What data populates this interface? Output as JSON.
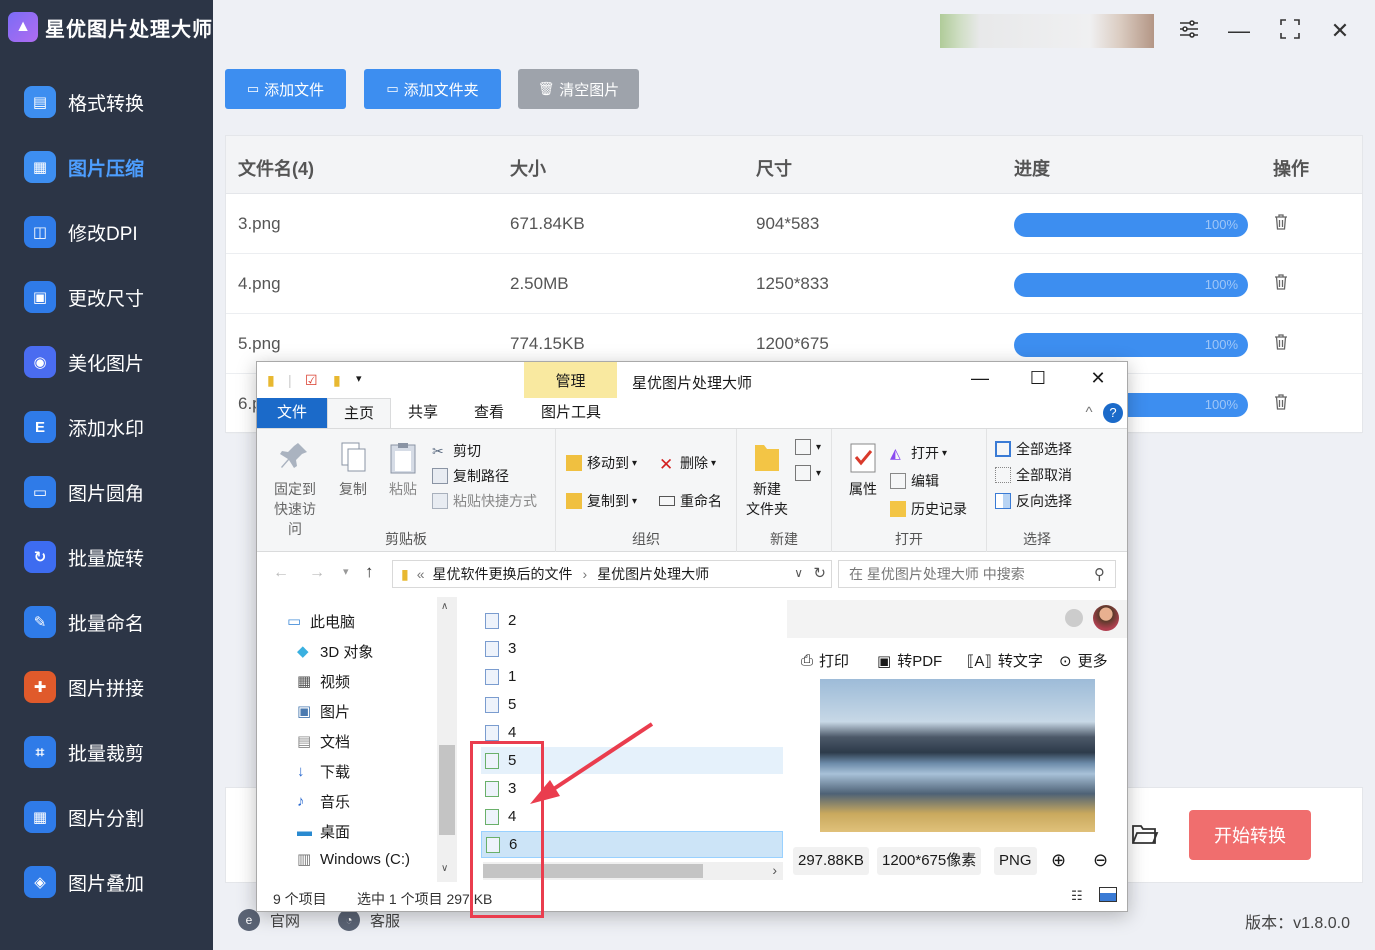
{
  "app": {
    "title": "星优图片处理大师",
    "version": "版本：v1.8.0.0"
  },
  "sidebar": {
    "items": [
      {
        "label": "格式转换",
        "color": "#3d8ef0"
      },
      {
        "label": "图片压缩",
        "color": "#3d8ef0",
        "active": true
      },
      {
        "label": "修改DPI",
        "color": "#2f7be8"
      },
      {
        "label": "更改尺寸",
        "color": "#2f7be8"
      },
      {
        "label": "美化图片",
        "color": "#4a6cf0"
      },
      {
        "label": "添加水印",
        "color": "#2f7be8"
      },
      {
        "label": "图片圆角",
        "color": "#2f7be8"
      },
      {
        "label": "批量旋转",
        "color": "#3d6cf0"
      },
      {
        "label": "批量命名",
        "color": "#2f7be8"
      },
      {
        "label": "图片拼接",
        "color": "#e05a2b"
      },
      {
        "label": "批量裁剪",
        "color": "#2f7be8"
      },
      {
        "label": "图片分割",
        "color": "#2f7be8"
      },
      {
        "label": "图片叠加",
        "color": "#2f7be8"
      }
    ]
  },
  "toolbar": {
    "add_file": "添加文件",
    "add_folder": "添加文件夹",
    "clear": "清空图片"
  },
  "table": {
    "headers": {
      "name": "文件名(4)",
      "size": "大小",
      "dims": "尺寸",
      "progress": "进度",
      "action": "操作"
    },
    "rows": [
      {
        "name": "3.png",
        "size": "671.84KB",
        "dims": "904*583",
        "progress": "100%"
      },
      {
        "name": "4.png",
        "size": "2.50MB",
        "dims": "1250*833",
        "progress": "100%"
      },
      {
        "name": "5.png",
        "size": "774.15KB",
        "dims": "1200*675",
        "progress": "100%"
      },
      {
        "name": "6.p",
        "size": "",
        "dims": "",
        "progress": "100%"
      }
    ]
  },
  "bottom": {
    "start": "开始转换",
    "site": "官网",
    "service": "客服"
  },
  "explorer": {
    "manage": "管理",
    "title": "星优图片处理大师",
    "tabs": {
      "file": "文件",
      "home": "主页",
      "share": "共享",
      "view": "查看",
      "picture_tools": "图片工具"
    },
    "ribbon": {
      "pin": "固定到",
      "pin2": "快速访问",
      "copy": "复制",
      "paste": "粘贴",
      "cut": "剪切",
      "copy_path": "复制路径",
      "paste_shortcut": "粘贴快捷方式",
      "clipboard": "剪贴板",
      "move_to": "移动到",
      "copy_to": "复制到",
      "delete": "删除",
      "rename": "重命名",
      "organize": "组织",
      "new_folder": "新建",
      "new_folder2": "文件夹",
      "new": "新建",
      "properties": "属性",
      "open": "打开",
      "edit": "编辑",
      "history": "历史记录",
      "open_group": "打开",
      "select_all": "全部选择",
      "select_none": "全部取消",
      "invert": "反向选择",
      "select": "选择"
    },
    "address": {
      "prefix": "«",
      "part1": "星优软件更换后的文件",
      "part2": "星优图片处理大师",
      "search": "在 星优图片处理大师 中搜索"
    },
    "tree": [
      "此电脑",
      "3D 对象",
      "视频",
      "图片",
      "文档",
      "下载",
      "音乐",
      "桌面",
      "Windows (C:)"
    ],
    "files": [
      "2",
      "3",
      "1",
      "5",
      "4",
      "5",
      "3",
      "4",
      "6"
    ],
    "preview": {
      "print": "打印",
      "to_pdf": "转PDF",
      "to_text": "转文字",
      "more": "更多",
      "size": "297.88KB",
      "dims": "1200*675像素",
      "format": "PNG"
    },
    "status": {
      "count": "9 个项目",
      "selected": "选中 1 个项目  297 KB"
    }
  }
}
